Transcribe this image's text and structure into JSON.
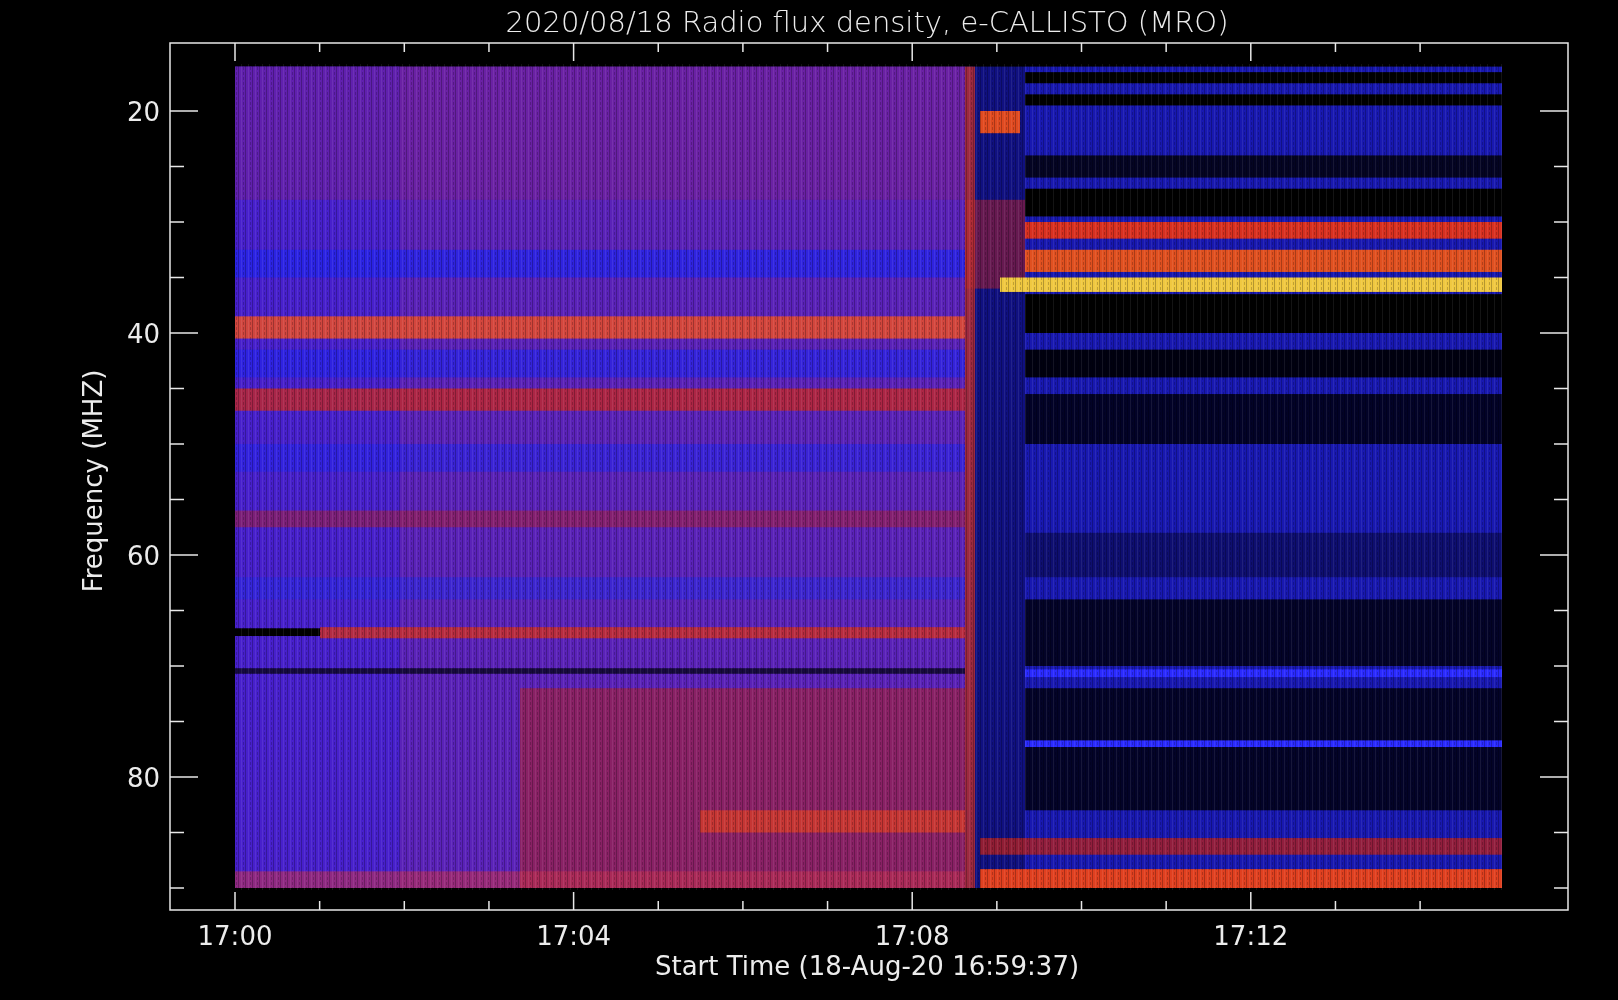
{
  "title": "2020/08/18  Radio flux density, e-CALLISTO (MRO)",
  "x_axis": {
    "label": "Start Time (18-Aug-20 16:59:37)",
    "ticks": [
      "17:00",
      "17:04",
      "17:08",
      "17:12"
    ]
  },
  "y_axis": {
    "label": "Frequency (MHZ)",
    "ticks": [
      "20",
      "40",
      "60",
      "80"
    ]
  }
}
